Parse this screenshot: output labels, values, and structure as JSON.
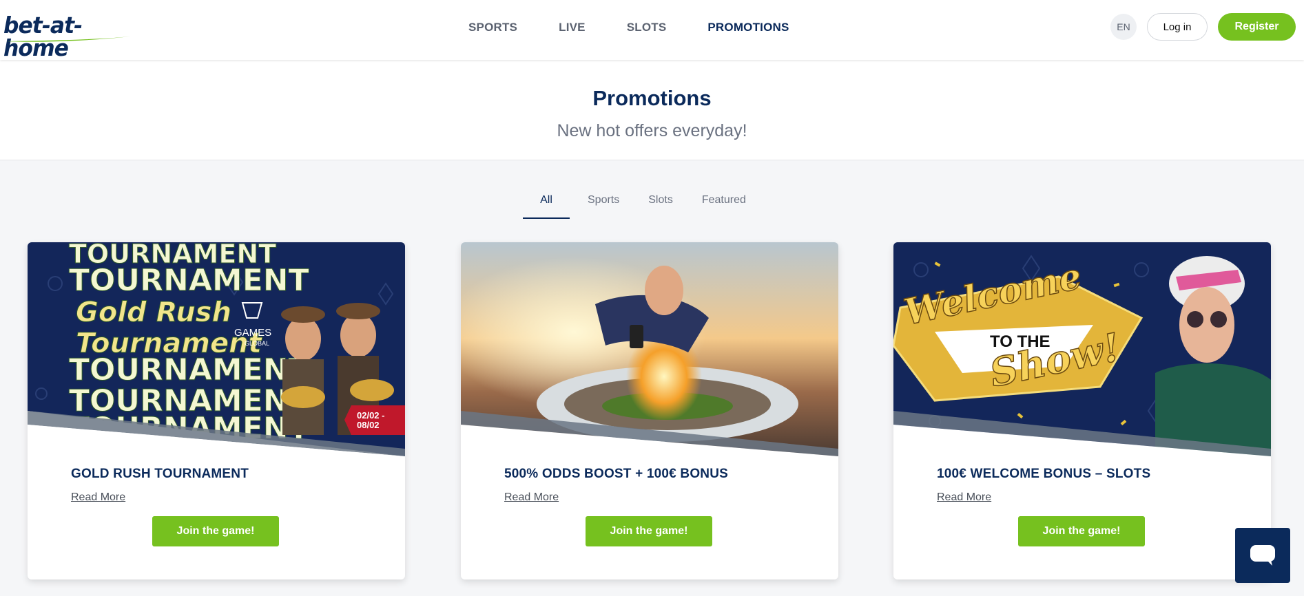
{
  "brand": {
    "logo_text": "bet-at-home"
  },
  "header": {
    "nav": [
      {
        "label": "SPORTS",
        "active": false
      },
      {
        "label": "LIVE",
        "active": false
      },
      {
        "label": "SLOTS",
        "active": false
      },
      {
        "label": "PROMOTIONS",
        "active": true
      }
    ],
    "language": "EN",
    "login_label": "Log in",
    "register_label": "Register"
  },
  "hero": {
    "title": "Promotions",
    "subtitle": "New hot offers everyday!"
  },
  "tabs": [
    {
      "label": "All",
      "active": true
    },
    {
      "label": "Sports",
      "active": false
    },
    {
      "label": "Slots",
      "active": false
    },
    {
      "label": "Featured",
      "active": false
    }
  ],
  "cards": [
    {
      "title": "GOLD RUSH TOURNAMENT",
      "read_more": "Read More",
      "button": "Join the game!",
      "image_text": {
        "line1": "TOURNAMENT",
        "line2": "TOURNAMENT",
        "script1": "Gold Rush",
        "script2": "Tournament",
        "line3": "TOURNAMENT",
        "line4": "TOURNAMENT",
        "line5": "TOURNAMENT",
        "brand": "GAMES",
        "brand_sub": "GLOBAL",
        "date1": "02/02 -",
        "date2": "08/02"
      }
    },
    {
      "title": "500% ODDS BOOST + 100€ BONUS",
      "read_more": "Read More",
      "button": "Join the game!"
    },
    {
      "title": "100€ WELCOME BONUS – SLOTS",
      "read_more": "Read More",
      "button": "Join the game!",
      "image_text": {
        "welcome": "Welcome",
        "to_the": "TO THE",
        "show": "Show!"
      }
    }
  ],
  "colors": {
    "brand_navy": "#0b2a5b",
    "accent_green": "#76c11f",
    "page_bg": "#f5f6f8"
  },
  "icons": {
    "chat": "chat-bubble-icon",
    "logo_swoosh": "logo-swoosh-icon",
    "games_global": "games-global-logo-icon"
  }
}
